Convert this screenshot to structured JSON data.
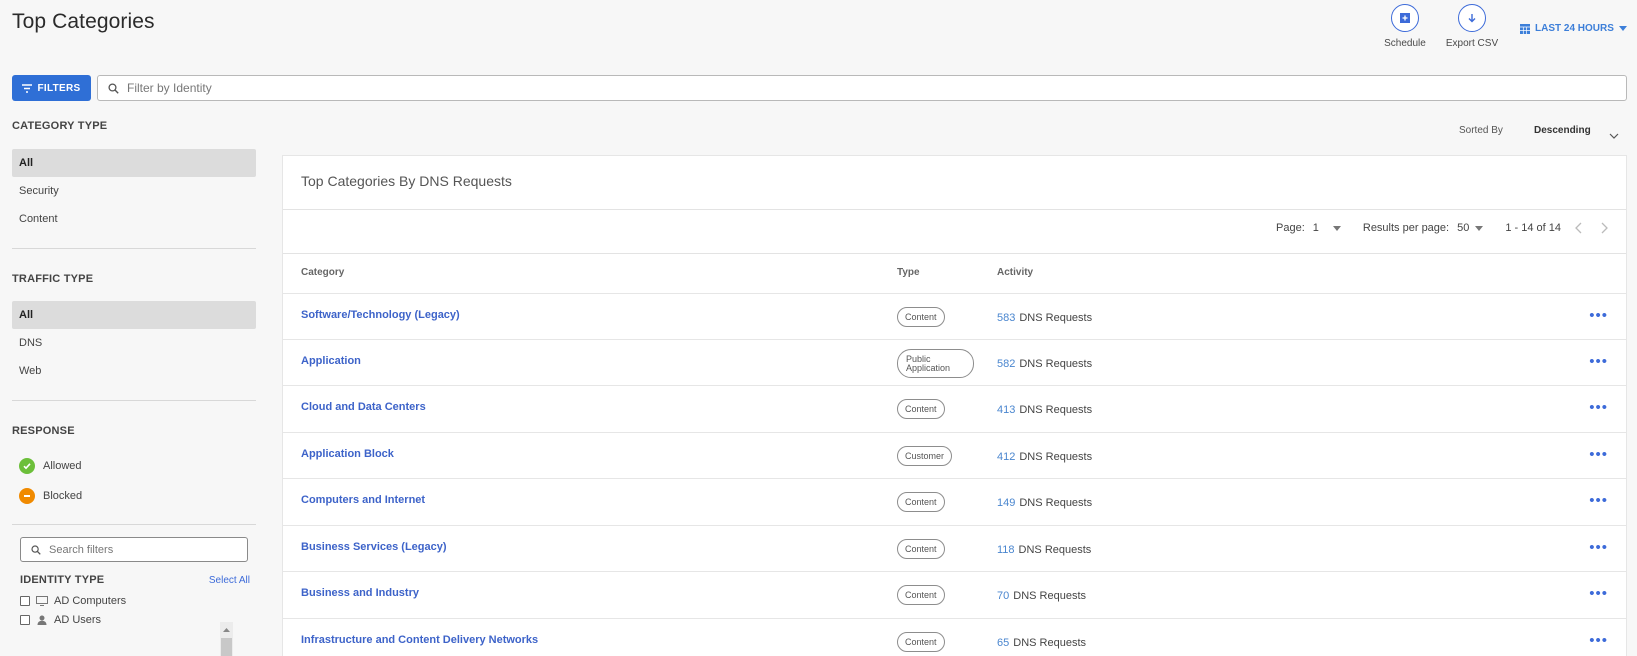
{
  "page": {
    "title": "Top Categories"
  },
  "header_actions": {
    "schedule_label": "Schedule",
    "export_label": "Export CSV",
    "time_range": "LAST 24 HOURS"
  },
  "filter_bar": {
    "filters_label": "FILTERS",
    "identity_placeholder": "Filter by Identity"
  },
  "sidebar": {
    "category_type": {
      "title": "CATEGORY TYPE",
      "items": [
        "All",
        "Security",
        "Content"
      ],
      "selected": "All"
    },
    "traffic_type": {
      "title": "TRAFFIC TYPE",
      "items": [
        "All",
        "DNS",
        "Web"
      ],
      "selected": "All"
    },
    "response": {
      "title": "RESPONSE",
      "items": [
        {
          "label": "Allowed",
          "color": "#6cbf3a"
        },
        {
          "label": "Blocked",
          "color": "#f08a00"
        }
      ]
    },
    "search_placeholder": "Search filters",
    "identity_type": {
      "title": "IDENTITY TYPE",
      "select_all": "Select All",
      "items": [
        {
          "label": "AD Computers",
          "icon": "monitor-icon"
        },
        {
          "label": "AD Users",
          "icon": "user-icon"
        }
      ]
    }
  },
  "sort": {
    "label": "Sorted By",
    "value": "Descending"
  },
  "table": {
    "title": "Top Categories By DNS Requests",
    "pager": {
      "page_label": "Page:",
      "page": "1",
      "rpp_label": "Results per page:",
      "rpp": "50",
      "range": "1 - 14 of 14"
    },
    "columns": [
      "Category",
      "Type",
      "Activity"
    ],
    "unit": "DNS Requests",
    "rows": [
      {
        "category": "Software/Technology (Legacy)",
        "type": "Content",
        "count": "583"
      },
      {
        "category": "Application",
        "type": "Public Application",
        "count": "582"
      },
      {
        "category": "Cloud and Data Centers",
        "type": "Content",
        "count": "413"
      },
      {
        "category": "Application Block",
        "type": "Customer",
        "count": "412"
      },
      {
        "category": "Computers and Internet",
        "type": "Content",
        "count": "149"
      },
      {
        "category": "Business Services (Legacy)",
        "type": "Content",
        "count": "118"
      },
      {
        "category": "Business and Industry",
        "type": "Content",
        "count": "70"
      },
      {
        "category": "Infrastructure and Content Delivery Networks",
        "type": "Content",
        "count": "65"
      }
    ]
  },
  "colors": {
    "accent": "#2f6fd6",
    "link": "#3d63c9",
    "count": "#4a86cf"
  }
}
